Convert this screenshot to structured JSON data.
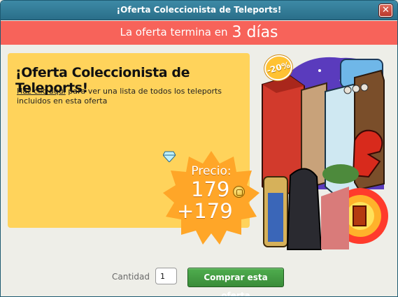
{
  "window": {
    "title": "¡Oferta Coleccionista de Teleports!",
    "close_label": "✕"
  },
  "banner": {
    "label": "La oferta termina en",
    "days": "3 días"
  },
  "offer": {
    "heading": "¡Oferta Coleccionista de Teleports!",
    "link_text": "Haz clic aquí",
    "description": " para ver  una lista de todos los teleports incluidos en esta oferta"
  },
  "price": {
    "label": "Precio:",
    "credits": "179",
    "diamonds": "+179",
    "credit_icon": "coin-icon",
    "diamond_icon": "diamond-icon"
  },
  "discount": "-20%",
  "purchase": {
    "quantity_label": "Cantidad",
    "quantity_value": "1",
    "buy_label": "Comprar esta oferta"
  },
  "colors": {
    "titlebar": "#2a6e89",
    "banner": "#f7635a",
    "panel": "#ffd35b",
    "badge": "#ffa628",
    "buy_button": "#3f963e"
  }
}
